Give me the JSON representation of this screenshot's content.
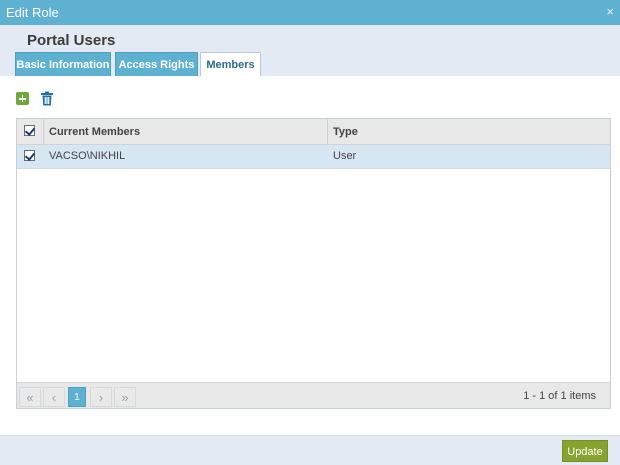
{
  "window": {
    "title": "Edit Role",
    "close_glyph": "×"
  },
  "role": {
    "name": "Portal Users"
  },
  "tabs": [
    {
      "label": "Basic Information",
      "active": false
    },
    {
      "label": "Access Rights",
      "active": false
    },
    {
      "label": "Members",
      "active": true
    }
  ],
  "toolbar": {
    "add_icon": "add-icon",
    "delete_icon": "trash-icon"
  },
  "grid": {
    "columns": [
      "Current Members",
      "Type"
    ],
    "header_checked": true,
    "rows": [
      {
        "member": "VACSO\\NIKHIL",
        "type": "User",
        "checked": true
      }
    ]
  },
  "pager": {
    "first": "«",
    "prev": "‹",
    "current_page": "1",
    "next": "›",
    "last": "»",
    "info": "1 - 1 of 1 items"
  },
  "footer": {
    "update_label": "Update"
  },
  "colors": {
    "accent": "#5fb1d2",
    "update_button": "#85a32d",
    "selected_row": "#d7e7f2"
  }
}
